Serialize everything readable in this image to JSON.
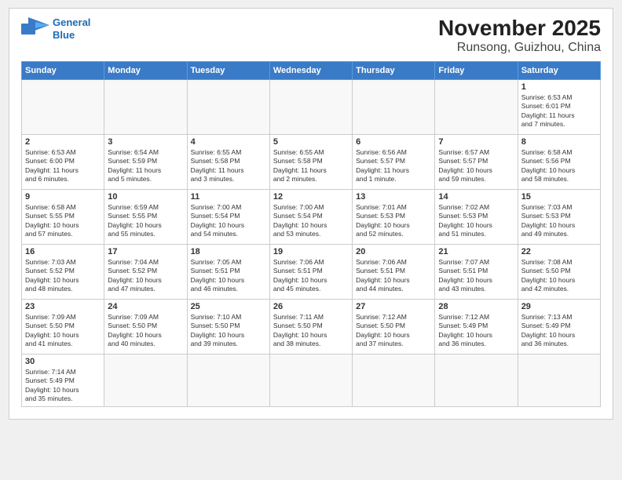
{
  "header": {
    "logo_line1": "General",
    "logo_line2": "Blue",
    "title": "November 2025",
    "subtitle": "Runsong, Guizhou, China"
  },
  "days_of_week": [
    "Sunday",
    "Monday",
    "Tuesday",
    "Wednesday",
    "Thursday",
    "Friday",
    "Saturday"
  ],
  "weeks": [
    [
      {
        "day": "",
        "info": ""
      },
      {
        "day": "",
        "info": ""
      },
      {
        "day": "",
        "info": ""
      },
      {
        "day": "",
        "info": ""
      },
      {
        "day": "",
        "info": ""
      },
      {
        "day": "",
        "info": ""
      },
      {
        "day": "1",
        "info": "Sunrise: 6:53 AM\nSunset: 6:01 PM\nDaylight: 11 hours\nand 7 minutes."
      }
    ],
    [
      {
        "day": "2",
        "info": "Sunrise: 6:53 AM\nSunset: 6:00 PM\nDaylight: 11 hours\nand 6 minutes."
      },
      {
        "day": "3",
        "info": "Sunrise: 6:54 AM\nSunset: 5:59 PM\nDaylight: 11 hours\nand 5 minutes."
      },
      {
        "day": "4",
        "info": "Sunrise: 6:55 AM\nSunset: 5:58 PM\nDaylight: 11 hours\nand 3 minutes."
      },
      {
        "day": "5",
        "info": "Sunrise: 6:55 AM\nSunset: 5:58 PM\nDaylight: 11 hours\nand 2 minutes."
      },
      {
        "day": "6",
        "info": "Sunrise: 6:56 AM\nSunset: 5:57 PM\nDaylight: 11 hours\nand 1 minute."
      },
      {
        "day": "7",
        "info": "Sunrise: 6:57 AM\nSunset: 5:57 PM\nDaylight: 10 hours\nand 59 minutes."
      },
      {
        "day": "8",
        "info": "Sunrise: 6:58 AM\nSunset: 5:56 PM\nDaylight: 10 hours\nand 58 minutes."
      }
    ],
    [
      {
        "day": "9",
        "info": "Sunrise: 6:58 AM\nSunset: 5:55 PM\nDaylight: 10 hours\nand 57 minutes."
      },
      {
        "day": "10",
        "info": "Sunrise: 6:59 AM\nSunset: 5:55 PM\nDaylight: 10 hours\nand 55 minutes."
      },
      {
        "day": "11",
        "info": "Sunrise: 7:00 AM\nSunset: 5:54 PM\nDaylight: 10 hours\nand 54 minutes."
      },
      {
        "day": "12",
        "info": "Sunrise: 7:00 AM\nSunset: 5:54 PM\nDaylight: 10 hours\nand 53 minutes."
      },
      {
        "day": "13",
        "info": "Sunrise: 7:01 AM\nSunset: 5:53 PM\nDaylight: 10 hours\nand 52 minutes."
      },
      {
        "day": "14",
        "info": "Sunrise: 7:02 AM\nSunset: 5:53 PM\nDaylight: 10 hours\nand 51 minutes."
      },
      {
        "day": "15",
        "info": "Sunrise: 7:03 AM\nSunset: 5:53 PM\nDaylight: 10 hours\nand 49 minutes."
      }
    ],
    [
      {
        "day": "16",
        "info": "Sunrise: 7:03 AM\nSunset: 5:52 PM\nDaylight: 10 hours\nand 48 minutes."
      },
      {
        "day": "17",
        "info": "Sunrise: 7:04 AM\nSunset: 5:52 PM\nDaylight: 10 hours\nand 47 minutes."
      },
      {
        "day": "18",
        "info": "Sunrise: 7:05 AM\nSunset: 5:51 PM\nDaylight: 10 hours\nand 46 minutes."
      },
      {
        "day": "19",
        "info": "Sunrise: 7:06 AM\nSunset: 5:51 PM\nDaylight: 10 hours\nand 45 minutes."
      },
      {
        "day": "20",
        "info": "Sunrise: 7:06 AM\nSunset: 5:51 PM\nDaylight: 10 hours\nand 44 minutes."
      },
      {
        "day": "21",
        "info": "Sunrise: 7:07 AM\nSunset: 5:51 PM\nDaylight: 10 hours\nand 43 minutes."
      },
      {
        "day": "22",
        "info": "Sunrise: 7:08 AM\nSunset: 5:50 PM\nDaylight: 10 hours\nand 42 minutes."
      }
    ],
    [
      {
        "day": "23",
        "info": "Sunrise: 7:09 AM\nSunset: 5:50 PM\nDaylight: 10 hours\nand 41 minutes."
      },
      {
        "day": "24",
        "info": "Sunrise: 7:09 AM\nSunset: 5:50 PM\nDaylight: 10 hours\nand 40 minutes."
      },
      {
        "day": "25",
        "info": "Sunrise: 7:10 AM\nSunset: 5:50 PM\nDaylight: 10 hours\nand 39 minutes."
      },
      {
        "day": "26",
        "info": "Sunrise: 7:11 AM\nSunset: 5:50 PM\nDaylight: 10 hours\nand 38 minutes."
      },
      {
        "day": "27",
        "info": "Sunrise: 7:12 AM\nSunset: 5:50 PM\nDaylight: 10 hours\nand 37 minutes."
      },
      {
        "day": "28",
        "info": "Sunrise: 7:12 AM\nSunset: 5:49 PM\nDaylight: 10 hours\nand 36 minutes."
      },
      {
        "day": "29",
        "info": "Sunrise: 7:13 AM\nSunset: 5:49 PM\nDaylight: 10 hours\nand 36 minutes."
      }
    ],
    [
      {
        "day": "30",
        "info": "Sunrise: 7:14 AM\nSunset: 5:49 PM\nDaylight: 10 hours\nand 35 minutes."
      },
      {
        "day": "",
        "info": ""
      },
      {
        "day": "",
        "info": ""
      },
      {
        "day": "",
        "info": ""
      },
      {
        "day": "",
        "info": ""
      },
      {
        "day": "",
        "info": ""
      },
      {
        "day": "",
        "info": ""
      }
    ]
  ]
}
